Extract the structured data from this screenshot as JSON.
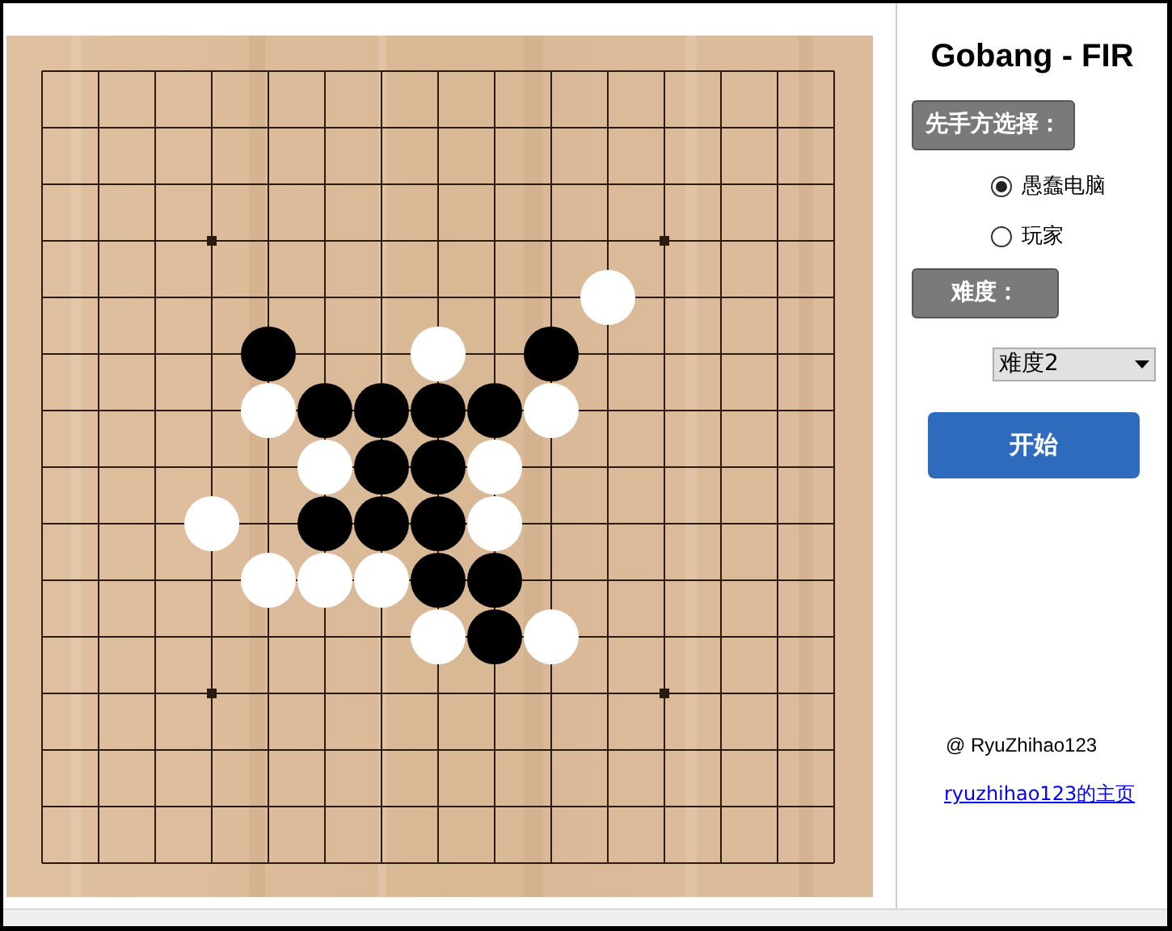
{
  "title": "Gobang - FIR",
  "board": {
    "rows": [
      [
        {
          "kind": "empty"
        },
        {
          "kind": "empty"
        },
        {
          "kind": "empty"
        },
        {
          "kind": "empty"
        },
        {
          "kind": "empty"
        },
        {
          "kind": "empty"
        },
        {
          "kind": "empty"
        },
        {
          "kind": "empty"
        },
        {
          "kind": "empty"
        },
        {
          "kind": "empty"
        },
        {
          "kind": "empty"
        },
        {
          "kind": "empty"
        },
        {
          "kind": "empty"
        },
        {
          "kind": "empty"
        },
        {
          "kind": "empty"
        }
      ],
      [
        {
          "kind": "empty"
        },
        {
          "kind": "empty"
        },
        {
          "kind": "empty"
        },
        {
          "kind": "empty"
        },
        {
          "kind": "empty"
        },
        {
          "kind": "empty"
        },
        {
          "kind": "empty"
        },
        {
          "kind": "empty"
        },
        {
          "kind": "empty"
        },
        {
          "kind": "empty"
        },
        {
          "kind": "empty"
        },
        {
          "kind": "empty"
        },
        {
          "kind": "empty"
        },
        {
          "kind": "empty"
        },
        {
          "kind": "empty"
        }
      ],
      [
        {
          "kind": "empty"
        },
        {
          "kind": "empty"
        },
        {
          "kind": "empty"
        },
        {
          "kind": "empty"
        },
        {
          "kind": "empty"
        },
        {
          "kind": "empty"
        },
        {
          "kind": "empty"
        },
        {
          "kind": "empty"
        },
        {
          "kind": "empty"
        },
        {
          "kind": "empty"
        },
        {
          "kind": "empty"
        },
        {
          "kind": "empty"
        },
        {
          "kind": "empty"
        },
        {
          "kind": "empty"
        },
        {
          "kind": "empty"
        }
      ],
      [
        {
          "kind": "empty"
        },
        {
          "kind": "empty"
        },
        {
          "kind": "empty"
        },
        {
          "kind": "empty"
        },
        {
          "kind": "empty"
        },
        {
          "kind": "empty"
        },
        {
          "kind": "empty"
        },
        {
          "kind": "empty"
        },
        {
          "kind": "empty"
        },
        {
          "kind": "empty"
        },
        {
          "kind": "empty"
        },
        {
          "kind": "empty"
        },
        {
          "kind": "empty"
        },
        {
          "kind": "empty"
        },
        {
          "kind": "empty"
        }
      ],
      [
        {
          "kind": "empty"
        },
        {
          "kind": "empty"
        },
        {
          "kind": "empty"
        },
        {
          "kind": "empty"
        },
        {
          "kind": "empty"
        },
        {
          "kind": "empty"
        },
        {
          "kind": "empty"
        },
        {
          "kind": "empty"
        },
        {
          "kind": "empty"
        },
        {
          "kind": "empty"
        },
        {
          "kind": "white"
        },
        {
          "kind": "empty"
        },
        {
          "kind": "empty"
        },
        {
          "kind": "empty"
        },
        {
          "kind": "empty"
        }
      ],
      [
        {
          "kind": "empty"
        },
        {
          "kind": "empty"
        },
        {
          "kind": "empty"
        },
        {
          "kind": "empty"
        },
        {
          "kind": "black"
        },
        {
          "kind": "empty"
        },
        {
          "kind": "empty"
        },
        {
          "kind": "white"
        },
        {
          "kind": "empty"
        },
        {
          "kind": "black"
        },
        {
          "kind": "empty"
        },
        {
          "kind": "empty"
        },
        {
          "kind": "empty"
        },
        {
          "kind": "empty"
        },
        {
          "kind": "empty"
        }
      ],
      [
        {
          "kind": "empty"
        },
        {
          "kind": "empty"
        },
        {
          "kind": "empty"
        },
        {
          "kind": "empty"
        },
        {
          "kind": "white"
        },
        {
          "kind": "black"
        },
        {
          "kind": "black"
        },
        {
          "kind": "black"
        },
        {
          "kind": "black"
        },
        {
          "kind": "white"
        },
        {
          "kind": "empty"
        },
        {
          "kind": "empty"
        },
        {
          "kind": "empty"
        },
        {
          "kind": "empty"
        },
        {
          "kind": "empty"
        }
      ],
      [
        {
          "kind": "empty"
        },
        {
          "kind": "empty"
        },
        {
          "kind": "empty"
        },
        {
          "kind": "empty"
        },
        {
          "kind": "empty"
        },
        {
          "kind": "white"
        },
        {
          "kind": "black"
        },
        {
          "kind": "black"
        },
        {
          "kind": "white"
        },
        {
          "kind": "empty"
        },
        {
          "kind": "empty"
        },
        {
          "kind": "empty"
        },
        {
          "kind": "empty"
        },
        {
          "kind": "empty"
        },
        {
          "kind": "empty"
        }
      ],
      [
        {
          "kind": "empty"
        },
        {
          "kind": "empty"
        },
        {
          "kind": "empty"
        },
        {
          "kind": "white"
        },
        {
          "kind": "empty"
        },
        {
          "kind": "black"
        },
        {
          "kind": "black"
        },
        {
          "kind": "black"
        },
        {
          "kind": "white"
        },
        {
          "kind": "empty"
        },
        {
          "kind": "empty"
        },
        {
          "kind": "empty"
        },
        {
          "kind": "empty"
        },
        {
          "kind": "empty"
        },
        {
          "kind": "empty"
        }
      ],
      [
        {
          "kind": "empty"
        },
        {
          "kind": "empty"
        },
        {
          "kind": "empty"
        },
        {
          "kind": "empty"
        },
        {
          "kind": "white"
        },
        {
          "kind": "white"
        },
        {
          "kind": "white"
        },
        {
          "kind": "black"
        },
        {
          "kind": "black"
        },
        {
          "kind": "empty"
        },
        {
          "kind": "empty"
        },
        {
          "kind": "empty"
        },
        {
          "kind": "empty"
        },
        {
          "kind": "empty"
        },
        {
          "kind": "empty"
        }
      ],
      [
        {
          "kind": "empty"
        },
        {
          "kind": "empty"
        },
        {
          "kind": "empty"
        },
        {
          "kind": "empty"
        },
        {
          "kind": "empty"
        },
        {
          "kind": "empty"
        },
        {
          "kind": "empty"
        },
        {
          "kind": "white"
        },
        {
          "kind": "black"
        },
        {
          "kind": "white"
        },
        {
          "kind": "empty"
        },
        {
          "kind": "empty"
        },
        {
          "kind": "empty"
        },
        {
          "kind": "empty"
        },
        {
          "kind": "empty"
        }
      ],
      [
        {
          "kind": "empty"
        },
        {
          "kind": "empty"
        },
        {
          "kind": "empty"
        },
        {
          "kind": "empty"
        },
        {
          "kind": "empty"
        },
        {
          "kind": "empty"
        },
        {
          "kind": "empty"
        },
        {
          "kind": "empty"
        },
        {
          "kind": "empty"
        },
        {
          "kind": "empty"
        },
        {
          "kind": "empty"
        },
        {
          "kind": "empty"
        },
        {
          "kind": "empty"
        },
        {
          "kind": "empty"
        },
        {
          "kind": "empty"
        }
      ],
      [
        {
          "kind": "empty"
        },
        {
          "kind": "empty"
        },
        {
          "kind": "empty"
        },
        {
          "kind": "empty"
        },
        {
          "kind": "empty"
        },
        {
          "kind": "empty"
        },
        {
          "kind": "empty"
        },
        {
          "kind": "empty"
        },
        {
          "kind": "empty"
        },
        {
          "kind": "empty"
        },
        {
          "kind": "empty"
        },
        {
          "kind": "empty"
        },
        {
          "kind": "empty"
        },
        {
          "kind": "empty"
        },
        {
          "kind": "empty"
        }
      ],
      [
        {
          "kind": "empty"
        },
        {
          "kind": "empty"
        },
        {
          "kind": "empty"
        },
        {
          "kind": "empty"
        },
        {
          "kind": "empty"
        },
        {
          "kind": "empty"
        },
        {
          "kind": "empty"
        },
        {
          "kind": "empty"
        },
        {
          "kind": "empty"
        },
        {
          "kind": "empty"
        },
        {
          "kind": "empty"
        },
        {
          "kind": "empty"
        },
        {
          "kind": "empty"
        },
        {
          "kind": "empty"
        },
        {
          "kind": "empty"
        }
      ],
      [
        {
          "kind": "empty"
        },
        {
          "kind": "empty"
        },
        {
          "kind": "empty"
        },
        {
          "kind": "empty"
        },
        {
          "kind": "empty"
        },
        {
          "kind": "empty"
        },
        {
          "kind": "empty"
        },
        {
          "kind": "empty"
        },
        {
          "kind": "empty"
        },
        {
          "kind": "empty"
        },
        {
          "kind": "empty"
        },
        {
          "kind": "empty"
        },
        {
          "kind": "empty"
        },
        {
          "kind": "empty"
        },
        {
          "kind": "empty"
        }
      ]
    ]
  },
  "first_player": {
    "label": "先手方选择：",
    "options": [
      {
        "label": "愚蠢电脑",
        "selected": true
      },
      {
        "label": "玩家",
        "selected": false
      }
    ]
  },
  "difficulty": {
    "label": "难度：",
    "value": "难度2"
  },
  "start_button": "开始",
  "author": "@ RyuZhihao123",
  "homepage_link": "ryuzhihao123的主页"
}
